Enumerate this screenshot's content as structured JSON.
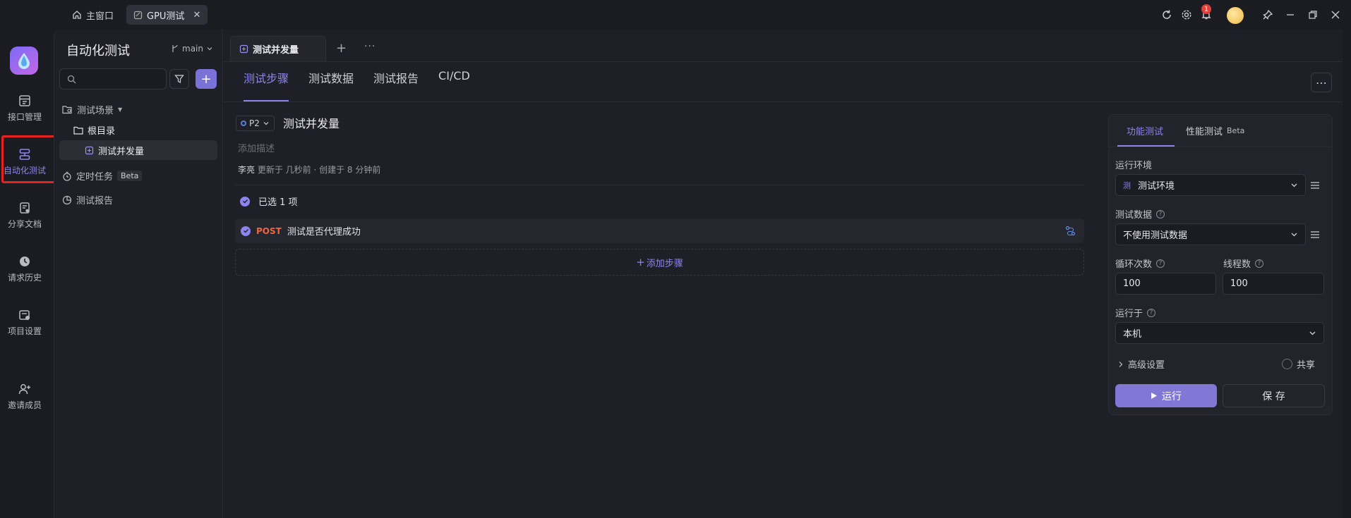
{
  "titlebar": {
    "home_tab": "主窗口",
    "project_tab": "GPU测试",
    "notification_count": "1"
  },
  "rail": {
    "items": [
      {
        "label": "接口管理",
        "icon": "api-icon"
      },
      {
        "label": "自动化测试",
        "icon": "automation-icon"
      },
      {
        "label": "分享文档",
        "icon": "share-doc-icon"
      },
      {
        "label": "请求历史",
        "icon": "history-icon"
      },
      {
        "label": "项目设置",
        "icon": "settings-icon"
      },
      {
        "label": "邀请成员",
        "icon": "invite-user-icon"
      }
    ],
    "active_index": 1
  },
  "tree": {
    "title": "自动化测试",
    "branch": "main",
    "search_placeholder": "",
    "scenes_label": "测试场景",
    "root_folder": "根目录",
    "selected_case": "测试并发量",
    "scheduled_label": "定时任务",
    "beta_label": "Beta",
    "reports_label": "测试报告"
  },
  "main": {
    "doc_tab": "测试并发量",
    "sub_tabs": [
      "测试步骤",
      "测试数据",
      "测试报告",
      "CI/CD"
    ],
    "active_sub_tab": 0,
    "priority": "P2",
    "case_title": "测试并发量",
    "description_placeholder": "添加描述",
    "meta_author": "李亮",
    "meta_text": "更新于 几秒前 · 创建于 8 分钟前",
    "selected_count": "已选 1 项",
    "steps": [
      {
        "method": "POST",
        "name": "测试是否代理成功"
      }
    ],
    "add_step": "添加步骤"
  },
  "run_panel": {
    "tabs": [
      "功能测试",
      "性能测试"
    ],
    "beta_label": "Beta",
    "env_label": "运行环境",
    "env_tag": "测",
    "env_value": "测试环境",
    "data_label": "测试数据",
    "data_value": "不使用测试数据",
    "loops_label": "循环次数",
    "loops_value": "100",
    "threads_label": "线程数",
    "threads_value": "100",
    "run_on_label": "运行于",
    "run_on_value": "本机",
    "advanced_label": "高级设置",
    "share_label": "共享",
    "run_button": "运行",
    "save_button": "保 存"
  },
  "colors": {
    "accent": "#8d84ee",
    "method_post": "#f0643f",
    "highlight_box": "#e6231e",
    "background": "#1b1b22"
  }
}
